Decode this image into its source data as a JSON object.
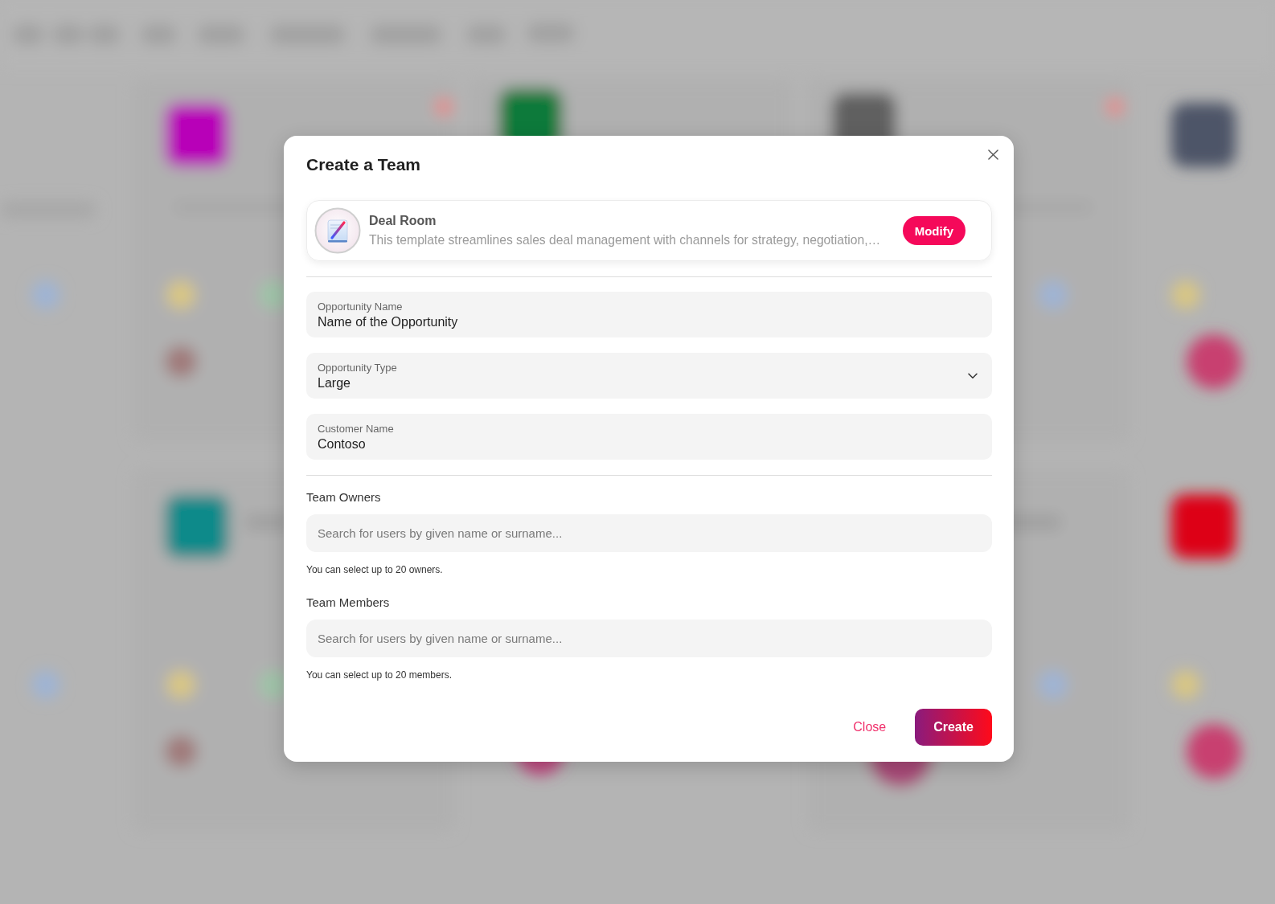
{
  "dialog": {
    "title": "Create a Team",
    "template": {
      "name": "Deal Room",
      "description": "This template streamlines sales deal management with channels for strategy, negotiation,…",
      "button": "Modify"
    },
    "fields": [
      {
        "kind": "text",
        "label": "Opportunity Name",
        "value": "Name of the Opportunity"
      },
      {
        "kind": "dropdown",
        "label": "Opportunity Type",
        "value": "Large"
      },
      {
        "kind": "text",
        "label": "Customer Name",
        "value": "Contoso"
      }
    ],
    "people_pickers": [
      {
        "label": "Team Owners",
        "placeholder": "Search for users by given name or surname...",
        "hint": "You can select up to 20 owners."
      },
      {
        "label": "Team Members",
        "placeholder": "Search for users by given name or surname...",
        "hint": "You can select up to 20 members."
      }
    ],
    "buttons": [
      {
        "kind": "text",
        "label": "Close"
      },
      {
        "kind": "primary",
        "label": "Create"
      }
    ]
  }
}
